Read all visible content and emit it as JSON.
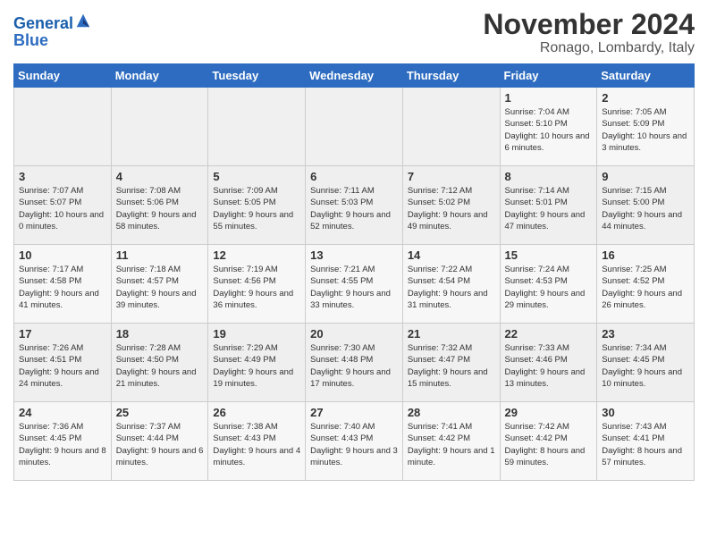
{
  "header": {
    "logo_general": "General",
    "logo_blue": "Blue",
    "month_title": "November 2024",
    "location": "Ronago, Lombardy, Italy"
  },
  "weekdays": [
    "Sunday",
    "Monday",
    "Tuesday",
    "Wednesday",
    "Thursday",
    "Friday",
    "Saturday"
  ],
  "weeks": [
    [
      {
        "day": "",
        "info": ""
      },
      {
        "day": "",
        "info": ""
      },
      {
        "day": "",
        "info": ""
      },
      {
        "day": "",
        "info": ""
      },
      {
        "day": "",
        "info": ""
      },
      {
        "day": "1",
        "info": "Sunrise: 7:04 AM\nSunset: 5:10 PM\nDaylight: 10 hours and 6 minutes."
      },
      {
        "day": "2",
        "info": "Sunrise: 7:05 AM\nSunset: 5:09 PM\nDaylight: 10 hours and 3 minutes."
      }
    ],
    [
      {
        "day": "3",
        "info": "Sunrise: 7:07 AM\nSunset: 5:07 PM\nDaylight: 10 hours and 0 minutes."
      },
      {
        "day": "4",
        "info": "Sunrise: 7:08 AM\nSunset: 5:06 PM\nDaylight: 9 hours and 58 minutes."
      },
      {
        "day": "5",
        "info": "Sunrise: 7:09 AM\nSunset: 5:05 PM\nDaylight: 9 hours and 55 minutes."
      },
      {
        "day": "6",
        "info": "Sunrise: 7:11 AM\nSunset: 5:03 PM\nDaylight: 9 hours and 52 minutes."
      },
      {
        "day": "7",
        "info": "Sunrise: 7:12 AM\nSunset: 5:02 PM\nDaylight: 9 hours and 49 minutes."
      },
      {
        "day": "8",
        "info": "Sunrise: 7:14 AM\nSunset: 5:01 PM\nDaylight: 9 hours and 47 minutes."
      },
      {
        "day": "9",
        "info": "Sunrise: 7:15 AM\nSunset: 5:00 PM\nDaylight: 9 hours and 44 minutes."
      }
    ],
    [
      {
        "day": "10",
        "info": "Sunrise: 7:17 AM\nSunset: 4:58 PM\nDaylight: 9 hours and 41 minutes."
      },
      {
        "day": "11",
        "info": "Sunrise: 7:18 AM\nSunset: 4:57 PM\nDaylight: 9 hours and 39 minutes."
      },
      {
        "day": "12",
        "info": "Sunrise: 7:19 AM\nSunset: 4:56 PM\nDaylight: 9 hours and 36 minutes."
      },
      {
        "day": "13",
        "info": "Sunrise: 7:21 AM\nSunset: 4:55 PM\nDaylight: 9 hours and 33 minutes."
      },
      {
        "day": "14",
        "info": "Sunrise: 7:22 AM\nSunset: 4:54 PM\nDaylight: 9 hours and 31 minutes."
      },
      {
        "day": "15",
        "info": "Sunrise: 7:24 AM\nSunset: 4:53 PM\nDaylight: 9 hours and 29 minutes."
      },
      {
        "day": "16",
        "info": "Sunrise: 7:25 AM\nSunset: 4:52 PM\nDaylight: 9 hours and 26 minutes."
      }
    ],
    [
      {
        "day": "17",
        "info": "Sunrise: 7:26 AM\nSunset: 4:51 PM\nDaylight: 9 hours and 24 minutes."
      },
      {
        "day": "18",
        "info": "Sunrise: 7:28 AM\nSunset: 4:50 PM\nDaylight: 9 hours and 21 minutes."
      },
      {
        "day": "19",
        "info": "Sunrise: 7:29 AM\nSunset: 4:49 PM\nDaylight: 9 hours and 19 minutes."
      },
      {
        "day": "20",
        "info": "Sunrise: 7:30 AM\nSunset: 4:48 PM\nDaylight: 9 hours and 17 minutes."
      },
      {
        "day": "21",
        "info": "Sunrise: 7:32 AM\nSunset: 4:47 PM\nDaylight: 9 hours and 15 minutes."
      },
      {
        "day": "22",
        "info": "Sunrise: 7:33 AM\nSunset: 4:46 PM\nDaylight: 9 hours and 13 minutes."
      },
      {
        "day": "23",
        "info": "Sunrise: 7:34 AM\nSunset: 4:45 PM\nDaylight: 9 hours and 10 minutes."
      }
    ],
    [
      {
        "day": "24",
        "info": "Sunrise: 7:36 AM\nSunset: 4:45 PM\nDaylight: 9 hours and 8 minutes."
      },
      {
        "day": "25",
        "info": "Sunrise: 7:37 AM\nSunset: 4:44 PM\nDaylight: 9 hours and 6 minutes."
      },
      {
        "day": "26",
        "info": "Sunrise: 7:38 AM\nSunset: 4:43 PM\nDaylight: 9 hours and 4 minutes."
      },
      {
        "day": "27",
        "info": "Sunrise: 7:40 AM\nSunset: 4:43 PM\nDaylight: 9 hours and 3 minutes."
      },
      {
        "day": "28",
        "info": "Sunrise: 7:41 AM\nSunset: 4:42 PM\nDaylight: 9 hours and 1 minute."
      },
      {
        "day": "29",
        "info": "Sunrise: 7:42 AM\nSunset: 4:42 PM\nDaylight: 8 hours and 59 minutes."
      },
      {
        "day": "30",
        "info": "Sunrise: 7:43 AM\nSunset: 4:41 PM\nDaylight: 8 hours and 57 minutes."
      }
    ]
  ]
}
